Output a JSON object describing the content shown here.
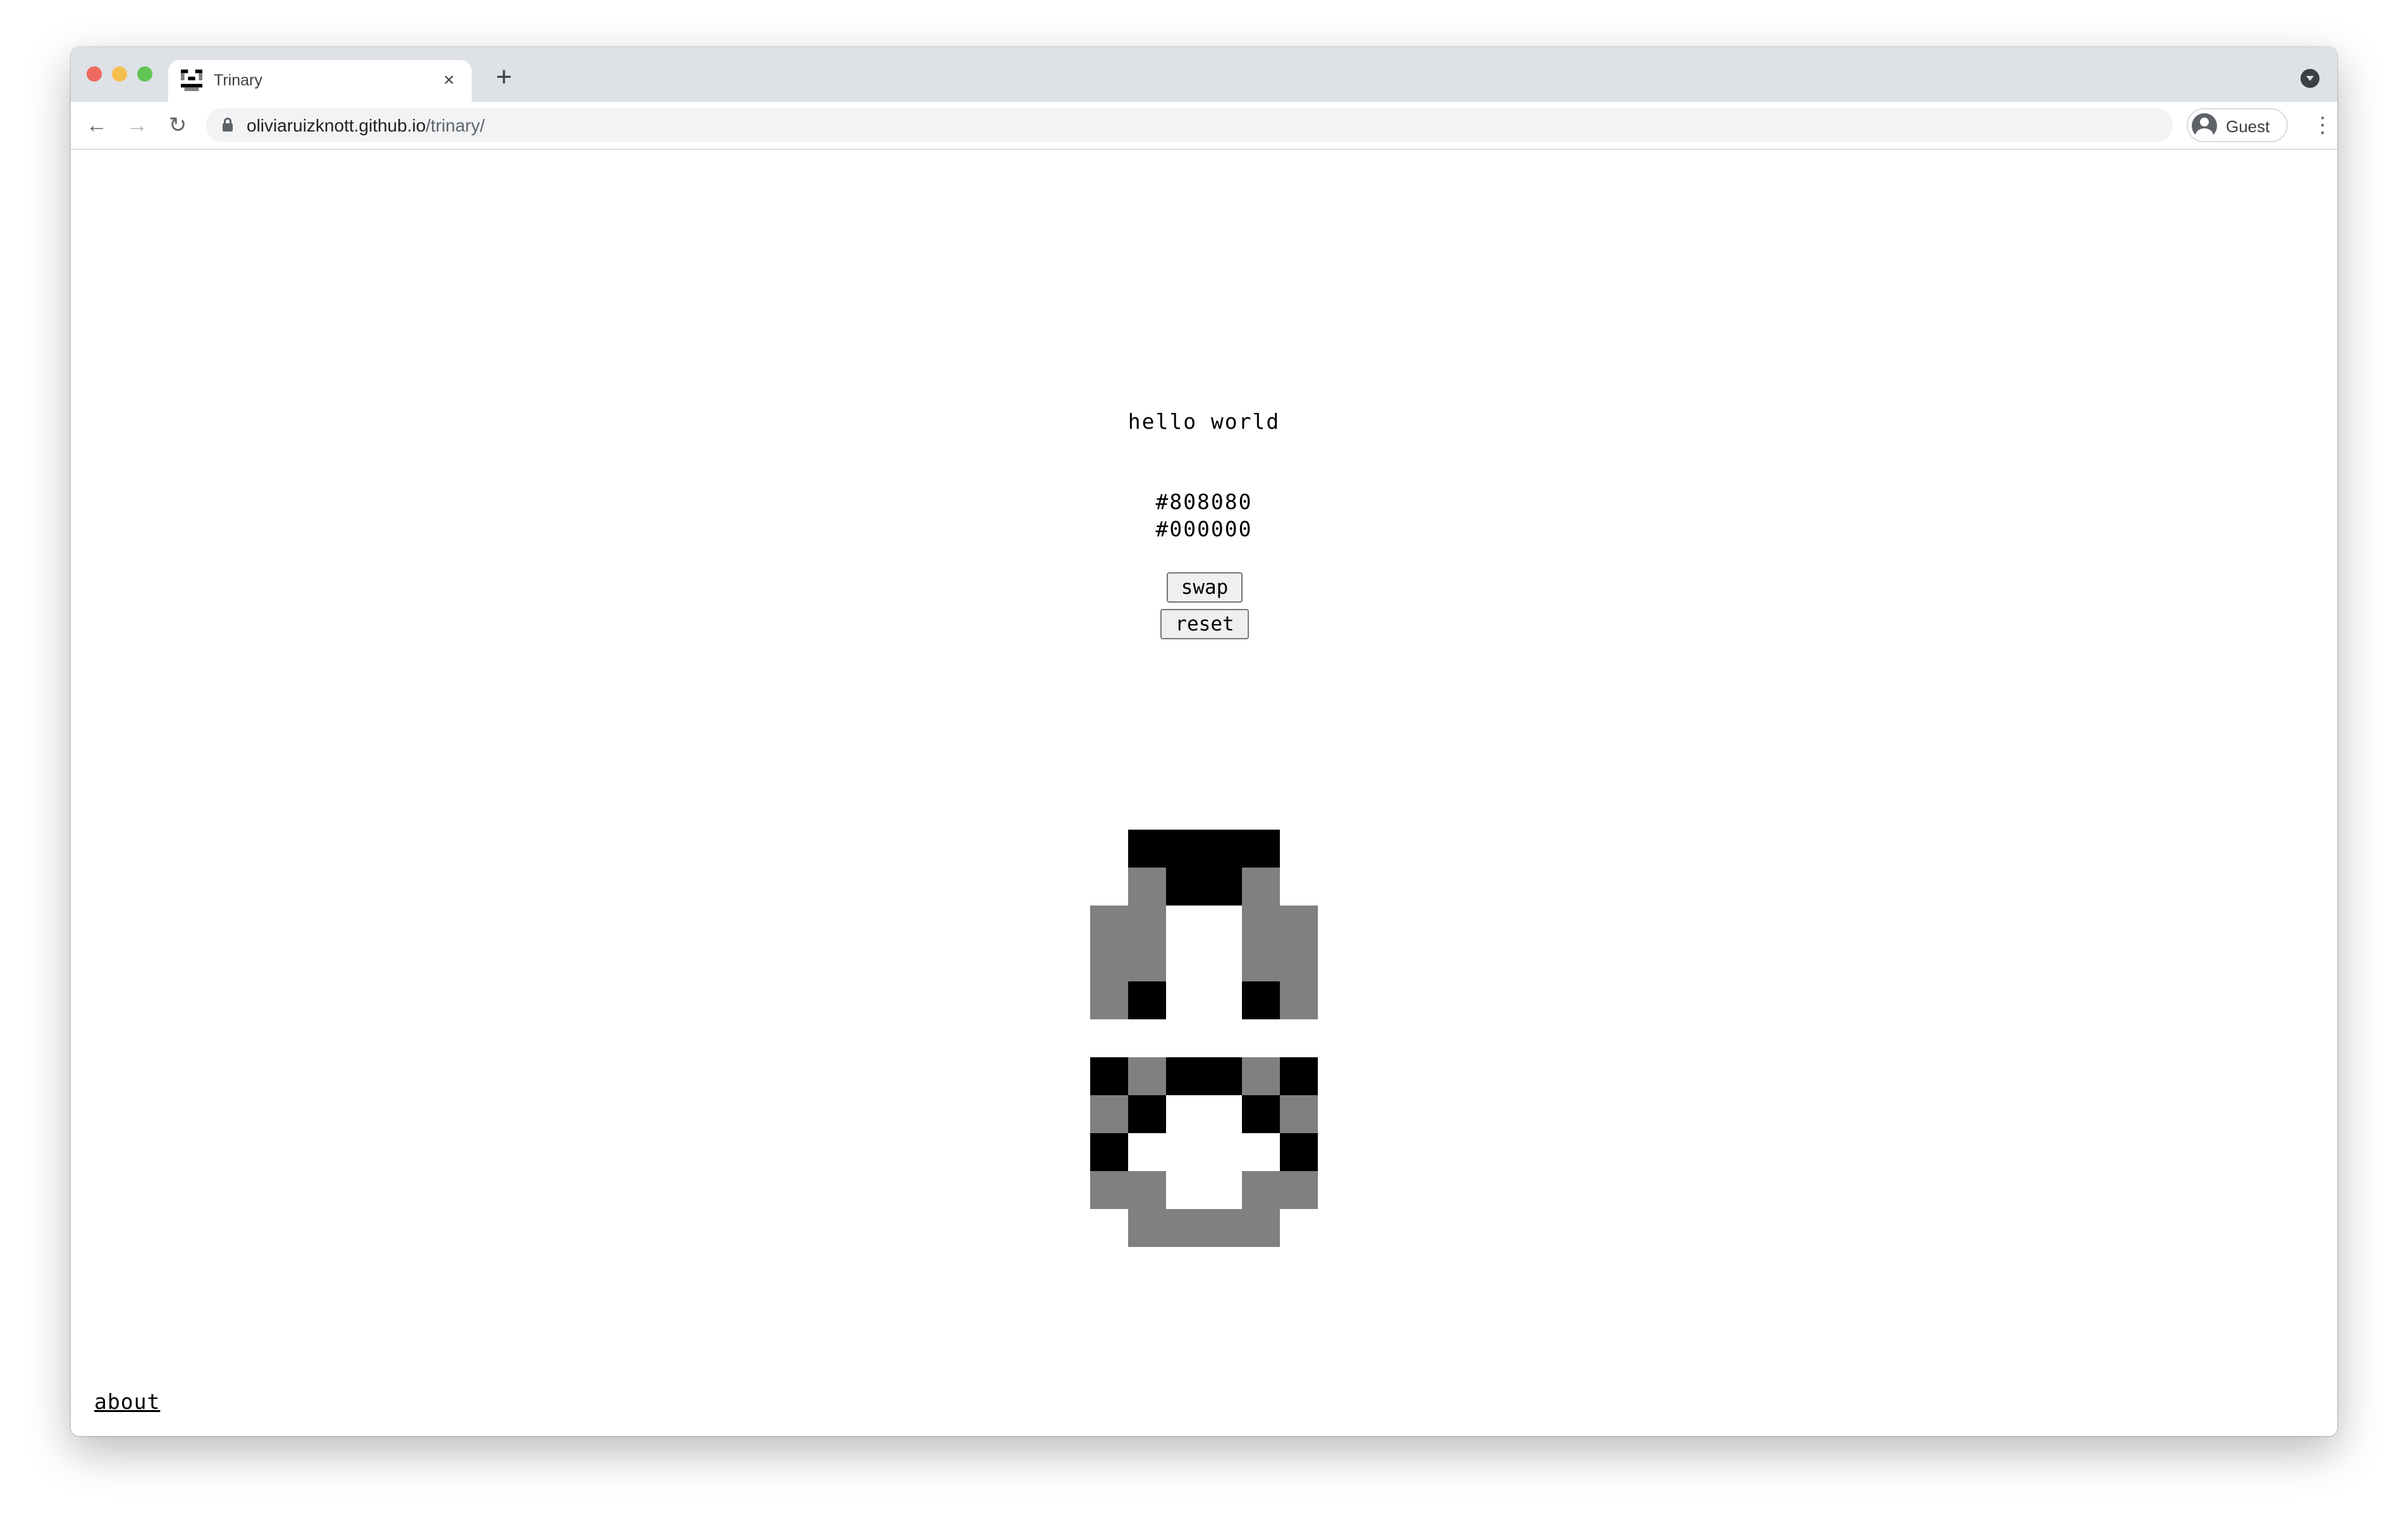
{
  "browser": {
    "tab_title": "Trinary",
    "close_glyph": "×",
    "new_tab_glyph": "+",
    "url_host": "oliviaruizknott.github.io",
    "url_path": "/trinary/",
    "profile_label": "Guest",
    "icons": [
      "favicon-icon",
      "close-icon",
      "plus-icon",
      "back-icon",
      "forward-icon",
      "reload-icon",
      "lock-icon",
      "avatar-icon",
      "menu-icon",
      "tab-search-icon"
    ]
  },
  "page": {
    "greeting": "hello world",
    "color_a": "#808080",
    "color_b": "#000000",
    "swap_label": "swap",
    "reset_label": "reset",
    "about_label": "about"
  },
  "glyphs": {
    "palette": {
      "0": "#ffffff",
      "1": "#808080",
      "2": "#000000"
    },
    "rows": [
      [
        "022220",
        "012210",
        "110011",
        "110011",
        "120021"
      ],
      [
        "212212",
        "120021",
        "200002",
        "110011",
        "011110"
      ]
    ]
  }
}
